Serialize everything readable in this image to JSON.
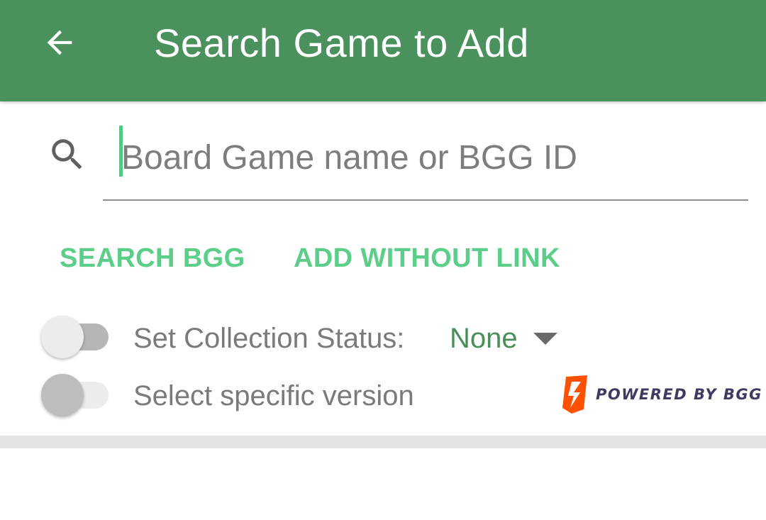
{
  "appbar": {
    "title": "Search Game to Add",
    "back_icon": "arrow-left-icon",
    "background_color": "#4a915d"
  },
  "search": {
    "icon": "search-icon",
    "placeholder": "Board Game name or BGG ID",
    "value": ""
  },
  "actions": {
    "search_bgg_label": "SEARCH BGG",
    "add_without_link_label": "ADD WITHOUT LINK",
    "accent_color": "#5dce8a"
  },
  "options": {
    "collection_status": {
      "label": "Set Collection Status:",
      "toggle_on": false,
      "selected_value": "None"
    },
    "specific_version": {
      "label": "Select specific version",
      "toggle_on": false
    }
  },
  "branding": {
    "logo_text": "POWERED BY BGG",
    "logo_icon": "bgg-logo-icon"
  }
}
